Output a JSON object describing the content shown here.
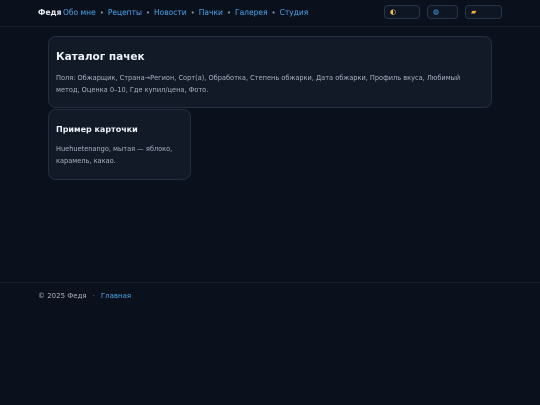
{
  "header": {
    "brand": "Федя",
    "nav": [
      "Обо мне",
      "Рецепты",
      "Новости",
      "Пачки",
      "Галерея",
      "Студия"
    ],
    "separator": "•",
    "controls": {
      "theme_icon": "moon-icon",
      "lang_icon": "globe-icon",
      "folder_icon": "folder-icon"
    }
  },
  "main": {
    "catalog": {
      "title": "Каталог пачек",
      "text": "Поля: Обжарщик, Страна→Регион, Сорт(а), Обработка, Степень обжарки, Дата обжарки, Профиль вкуса, Любимый метод, Оценка 0–10, Где купил/цена, Фото."
    },
    "example": {
      "title": "Пример карточки",
      "text": "Huehuetenango, мытая — яблоко, карамель, какао."
    }
  },
  "footer": {
    "copyright": "© 2025 Федя",
    "separator": "·",
    "home_link": "Главная"
  },
  "colors": {
    "background": "#0b111c",
    "card": "#121a28",
    "accent": "#4aa6ee"
  }
}
